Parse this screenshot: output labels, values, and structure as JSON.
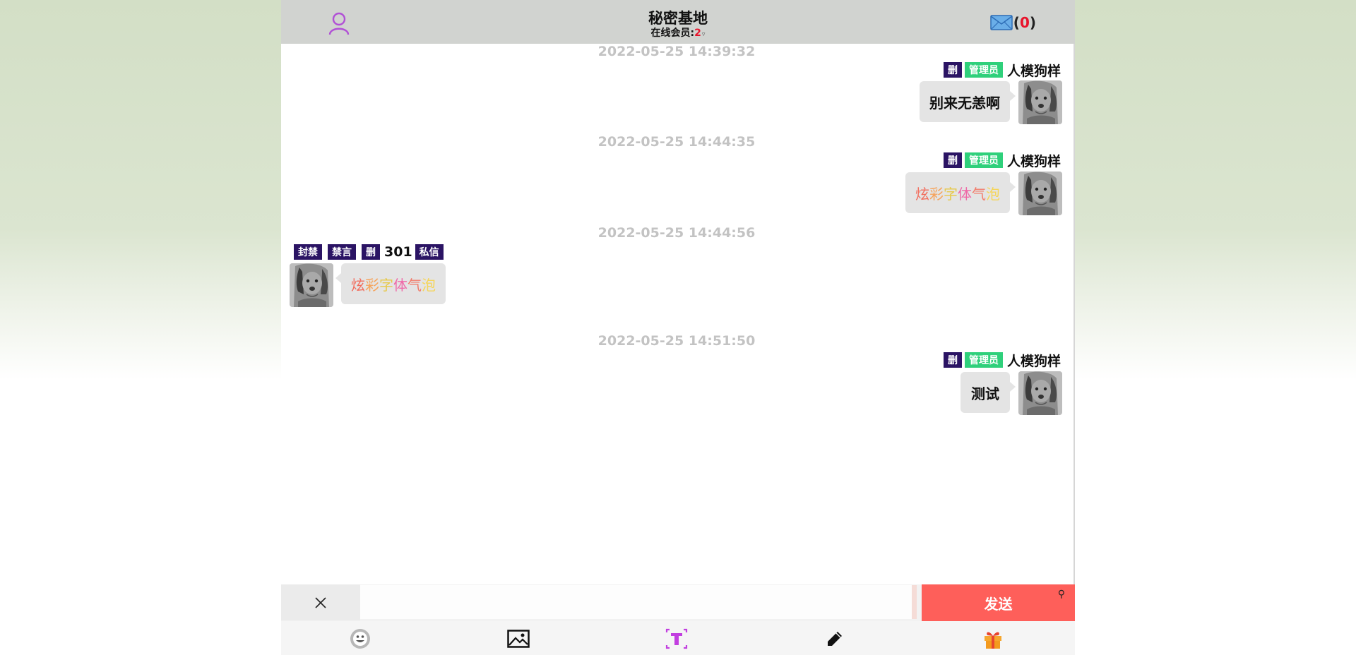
{
  "header": {
    "title": "秘密基地",
    "online_label": "在线会员:",
    "online_count": "2",
    "online_caret": "▿",
    "mail_open": "(",
    "mail_count": "0",
    "mail_close": ")"
  },
  "messages": [
    {
      "timestamp": "2022-05-25 14:39:32",
      "side": "right",
      "buttons": [
        "删"
      ],
      "badge": "管理员",
      "username": "人模狗样",
      "text": "别来无恙啊"
    },
    {
      "timestamp": "2022-05-25 14:44:35",
      "side": "right",
      "buttons": [
        "删"
      ],
      "badge": "管理员",
      "username": "人模狗样",
      "text": "炫彩字体气泡",
      "style": "rainbow"
    },
    {
      "timestamp": "2022-05-25 14:44:56",
      "side": "left",
      "buttons": [
        "封禁",
        "禁言",
        "删"
      ],
      "username": "301",
      "private_label": "私信",
      "text": "炫彩字体气泡",
      "style": "rainbow"
    },
    {
      "timestamp": "2022-05-25 14:51:50",
      "side": "right",
      "buttons": [
        "删"
      ],
      "badge": "管理员",
      "username": "人模狗样",
      "text": "测试"
    }
  ],
  "rainbow_colors": [
    "#f26b5b",
    "#f6a35b",
    "#e7c94a",
    "#ef6aa8",
    "#f27b6a",
    "#f5d55a"
  ],
  "input": {
    "close_icon": "close-icon",
    "value": "",
    "send_label": "发送",
    "pin_glyph": "⚲"
  },
  "toolbar": {
    "icons": [
      "emoji-icon",
      "image-icon",
      "text-style-icon",
      "pen-icon",
      "gift-icon"
    ]
  },
  "colors": {
    "header_bg": "#d1d3d0",
    "admin_badge": "#2fd07b",
    "action_tag": "#2b1464",
    "send_button": "#fe5f5a",
    "alert_red": "#e8132b"
  }
}
